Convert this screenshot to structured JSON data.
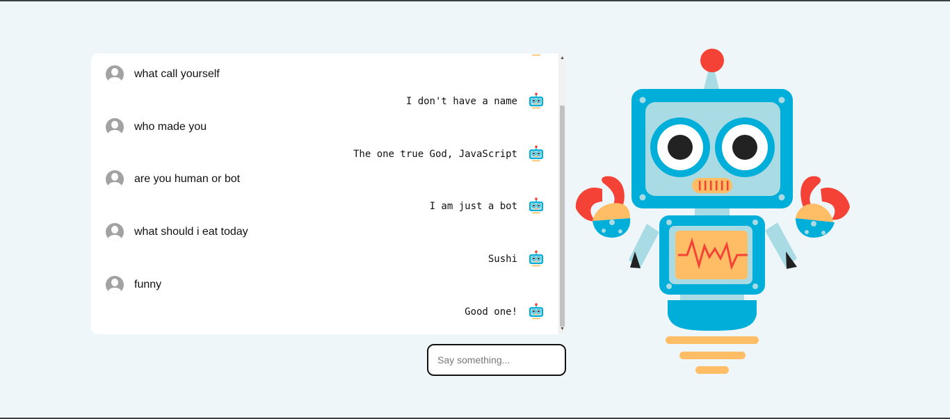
{
  "conversation": [
    {
      "sender": "user",
      "text": "what call yourself"
    },
    {
      "sender": "bot",
      "text": "I don't have a name"
    },
    {
      "sender": "user",
      "text": "who made you"
    },
    {
      "sender": "bot",
      "text": "The one true God, JavaScript"
    },
    {
      "sender": "user",
      "text": "are you human or bot"
    },
    {
      "sender": "bot",
      "text": "I am just a bot"
    },
    {
      "sender": "user",
      "text": "what should i eat today"
    },
    {
      "sender": "bot",
      "text": "Sushi"
    },
    {
      "sender": "user",
      "text": "funny"
    },
    {
      "sender": "bot",
      "text": "Good one!"
    }
  ],
  "input": {
    "placeholder": "Say something...",
    "value": ""
  },
  "colors": {
    "page_background": "#eef6f9",
    "robot_blue": "#00afd9",
    "robot_light_blue": "#a9dbe5",
    "robot_red": "#f44336",
    "robot_orange": "#ffbd66"
  },
  "icons": {
    "user_avatar": "user-avatar-icon",
    "bot_avatar": "robot-avatar-icon"
  }
}
